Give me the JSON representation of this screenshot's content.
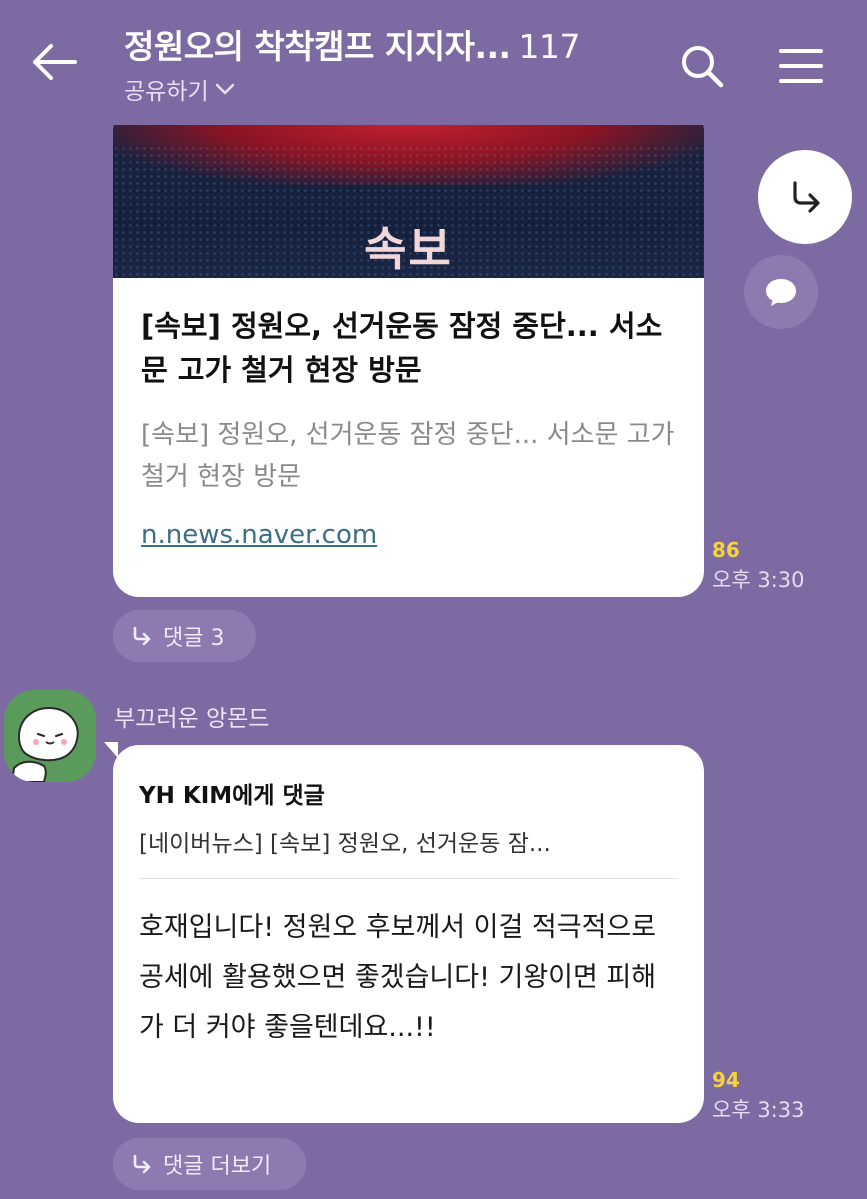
{
  "header": {
    "title": "정원오의 착착캠프 지지자...",
    "member_count": "117",
    "share_label": "공유하기"
  },
  "message1": {
    "image_text": "속보",
    "title": "[속보] 정원오, 선거운동 잠정 중단... 서소문 고가 철거 현장 방문",
    "description": "[속보] 정원오, 선거운동 잠정 중단... 서소문 고가 철거 현장 방문",
    "link": "n.news.naver.com",
    "unread_count": "86",
    "time": "오후 3:30",
    "reply_label": "댓글 3"
  },
  "message2": {
    "sender": "부끄러운 앙몬드",
    "reply_to": "YH KIM에게 댓글",
    "quote": "[네이버뉴스] [속보] 정원오, 선거운동 잠...",
    "text": "호재입니다! 정원오 후보께서 이걸 적극적으로 공세에 활용했으면 좋겠습니다! 기왕이면 피해가 더 커야 좋을텐데요...!!",
    "unread_count": "94",
    "time": "오후 3:33",
    "reply_label": "댓글 더보기"
  },
  "colors": {
    "background": "#7d6aa3",
    "unread": "#f5d33a",
    "link": "#3e6e86",
    "avatar": "#5a9b5c"
  },
  "icons": [
    "back-arrow-icon",
    "search-icon",
    "menu-icon",
    "chevron-down-icon",
    "forward-icon",
    "speech-bubble-icon",
    "reply-arrow-icon"
  ]
}
